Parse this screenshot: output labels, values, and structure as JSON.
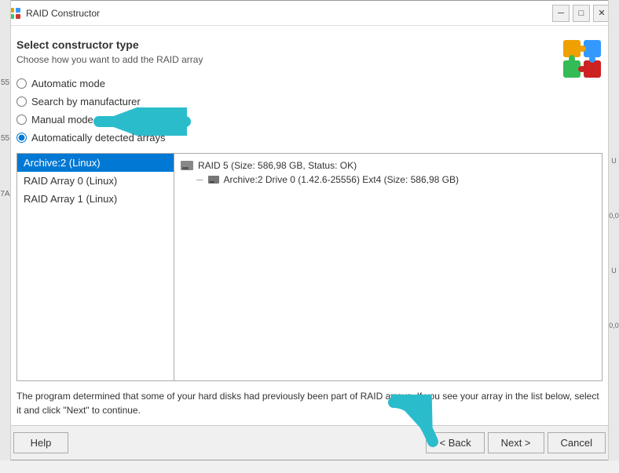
{
  "window": {
    "title": "RAID Constructor",
    "minimize_label": "─",
    "maximize_label": "□",
    "close_label": "✕"
  },
  "header": {
    "title": "Select constructor type",
    "subtitle": "Choose how you want to add the RAID array"
  },
  "radio_options": [
    {
      "id": "auto",
      "label": "Automatic mode",
      "checked": false
    },
    {
      "id": "search",
      "label": "Search by manufacturer",
      "checked": false
    },
    {
      "id": "manual",
      "label": "Manual mode",
      "checked": false
    },
    {
      "id": "detected",
      "label": "Automatically detected arrays",
      "checked": true
    }
  ],
  "list_items": [
    {
      "label": "Archive:2 (Linux)",
      "selected": true
    },
    {
      "label": "RAID Array 0 (Linux)",
      "selected": false
    },
    {
      "label": "RAID Array 1 (Linux)",
      "selected": false
    }
  ],
  "tree_items": [
    {
      "label": "RAID 5 (Size: 586,98 GB, Status: OK)",
      "indent": false
    },
    {
      "label": "Archive:2 Drive 0 (1.42.6-25556) Ext4 (Size: 586,98 GB)",
      "indent": true
    }
  ],
  "info_text": "The program determined that some of your hard disks had previously been part of RAID arrays. If you see your array in the list below, select it and click \"Next\" to continue.",
  "buttons": {
    "help": "Help",
    "back": "< Back",
    "next": "Next >",
    "cancel": "Cancel"
  },
  "sidebar_values": [
    "55",
    "55",
    "7A"
  ],
  "colors": {
    "selected_bg": "#0078d4",
    "arrow_cyan": "#3dc8d0"
  }
}
